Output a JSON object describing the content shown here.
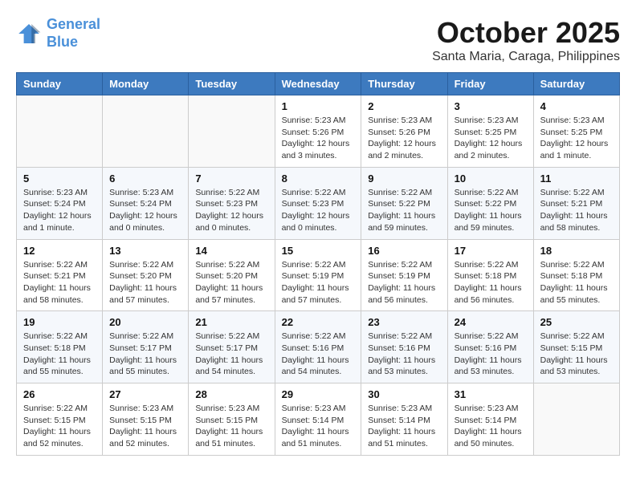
{
  "header": {
    "logo_line1": "General",
    "logo_line2": "Blue",
    "month_title": "October 2025",
    "subtitle": "Santa Maria, Caraga, Philippines"
  },
  "weekdays": [
    "Sunday",
    "Monday",
    "Tuesday",
    "Wednesday",
    "Thursday",
    "Friday",
    "Saturday"
  ],
  "weeks": [
    [
      {
        "day": "",
        "info": ""
      },
      {
        "day": "",
        "info": ""
      },
      {
        "day": "",
        "info": ""
      },
      {
        "day": "1",
        "info": "Sunrise: 5:23 AM\nSunset: 5:26 PM\nDaylight: 12 hours\nand 3 minutes."
      },
      {
        "day": "2",
        "info": "Sunrise: 5:23 AM\nSunset: 5:26 PM\nDaylight: 12 hours\nand 2 minutes."
      },
      {
        "day": "3",
        "info": "Sunrise: 5:23 AM\nSunset: 5:25 PM\nDaylight: 12 hours\nand 2 minutes."
      },
      {
        "day": "4",
        "info": "Sunrise: 5:23 AM\nSunset: 5:25 PM\nDaylight: 12 hours\nand 1 minute."
      }
    ],
    [
      {
        "day": "5",
        "info": "Sunrise: 5:23 AM\nSunset: 5:24 PM\nDaylight: 12 hours\nand 1 minute."
      },
      {
        "day": "6",
        "info": "Sunrise: 5:23 AM\nSunset: 5:24 PM\nDaylight: 12 hours\nand 0 minutes."
      },
      {
        "day": "7",
        "info": "Sunrise: 5:22 AM\nSunset: 5:23 PM\nDaylight: 12 hours\nand 0 minutes."
      },
      {
        "day": "8",
        "info": "Sunrise: 5:22 AM\nSunset: 5:23 PM\nDaylight: 12 hours\nand 0 minutes."
      },
      {
        "day": "9",
        "info": "Sunrise: 5:22 AM\nSunset: 5:22 PM\nDaylight: 11 hours\nand 59 minutes."
      },
      {
        "day": "10",
        "info": "Sunrise: 5:22 AM\nSunset: 5:22 PM\nDaylight: 11 hours\nand 59 minutes."
      },
      {
        "day": "11",
        "info": "Sunrise: 5:22 AM\nSunset: 5:21 PM\nDaylight: 11 hours\nand 58 minutes."
      }
    ],
    [
      {
        "day": "12",
        "info": "Sunrise: 5:22 AM\nSunset: 5:21 PM\nDaylight: 11 hours\nand 58 minutes."
      },
      {
        "day": "13",
        "info": "Sunrise: 5:22 AM\nSunset: 5:20 PM\nDaylight: 11 hours\nand 57 minutes."
      },
      {
        "day": "14",
        "info": "Sunrise: 5:22 AM\nSunset: 5:20 PM\nDaylight: 11 hours\nand 57 minutes."
      },
      {
        "day": "15",
        "info": "Sunrise: 5:22 AM\nSunset: 5:19 PM\nDaylight: 11 hours\nand 57 minutes."
      },
      {
        "day": "16",
        "info": "Sunrise: 5:22 AM\nSunset: 5:19 PM\nDaylight: 11 hours\nand 56 minutes."
      },
      {
        "day": "17",
        "info": "Sunrise: 5:22 AM\nSunset: 5:18 PM\nDaylight: 11 hours\nand 56 minutes."
      },
      {
        "day": "18",
        "info": "Sunrise: 5:22 AM\nSunset: 5:18 PM\nDaylight: 11 hours\nand 55 minutes."
      }
    ],
    [
      {
        "day": "19",
        "info": "Sunrise: 5:22 AM\nSunset: 5:18 PM\nDaylight: 11 hours\nand 55 minutes."
      },
      {
        "day": "20",
        "info": "Sunrise: 5:22 AM\nSunset: 5:17 PM\nDaylight: 11 hours\nand 55 minutes."
      },
      {
        "day": "21",
        "info": "Sunrise: 5:22 AM\nSunset: 5:17 PM\nDaylight: 11 hours\nand 54 minutes."
      },
      {
        "day": "22",
        "info": "Sunrise: 5:22 AM\nSunset: 5:16 PM\nDaylight: 11 hours\nand 54 minutes."
      },
      {
        "day": "23",
        "info": "Sunrise: 5:22 AM\nSunset: 5:16 PM\nDaylight: 11 hours\nand 53 minutes."
      },
      {
        "day": "24",
        "info": "Sunrise: 5:22 AM\nSunset: 5:16 PM\nDaylight: 11 hours\nand 53 minutes."
      },
      {
        "day": "25",
        "info": "Sunrise: 5:22 AM\nSunset: 5:15 PM\nDaylight: 11 hours\nand 53 minutes."
      }
    ],
    [
      {
        "day": "26",
        "info": "Sunrise: 5:22 AM\nSunset: 5:15 PM\nDaylight: 11 hours\nand 52 minutes."
      },
      {
        "day": "27",
        "info": "Sunrise: 5:23 AM\nSunset: 5:15 PM\nDaylight: 11 hours\nand 52 minutes."
      },
      {
        "day": "28",
        "info": "Sunrise: 5:23 AM\nSunset: 5:15 PM\nDaylight: 11 hours\nand 51 minutes."
      },
      {
        "day": "29",
        "info": "Sunrise: 5:23 AM\nSunset: 5:14 PM\nDaylight: 11 hours\nand 51 minutes."
      },
      {
        "day": "30",
        "info": "Sunrise: 5:23 AM\nSunset: 5:14 PM\nDaylight: 11 hours\nand 51 minutes."
      },
      {
        "day": "31",
        "info": "Sunrise: 5:23 AM\nSunset: 5:14 PM\nDaylight: 11 hours\nand 50 minutes."
      },
      {
        "day": "",
        "info": ""
      }
    ]
  ]
}
